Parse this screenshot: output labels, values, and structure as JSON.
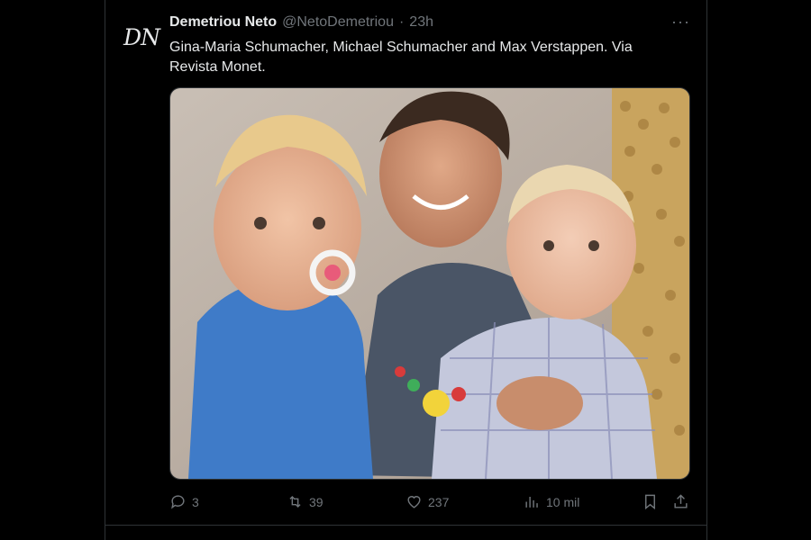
{
  "tweet": {
    "avatar_text": "DN",
    "display_name": "Demetriou Neto",
    "handle": "@NetoDemetriou",
    "separator": "·",
    "time": "23h",
    "more_label": "···",
    "text": "Gina-Maria Schumacher, Michael Schumacher and Max Verstappen. Via Revista Monet.",
    "actions": {
      "replies": "3",
      "retweets": "39",
      "likes": "237",
      "views": "10 mil"
    }
  },
  "icons": {
    "reply": "reply-icon",
    "retweet": "retweet-icon",
    "like": "heart-icon",
    "views": "views-icon",
    "bookmark": "bookmark-icon",
    "share": "share-icon"
  },
  "colors": {
    "background": "#000000",
    "text_primary": "#e7e9ea",
    "text_secondary": "#71767b",
    "border": "#2f3336"
  }
}
